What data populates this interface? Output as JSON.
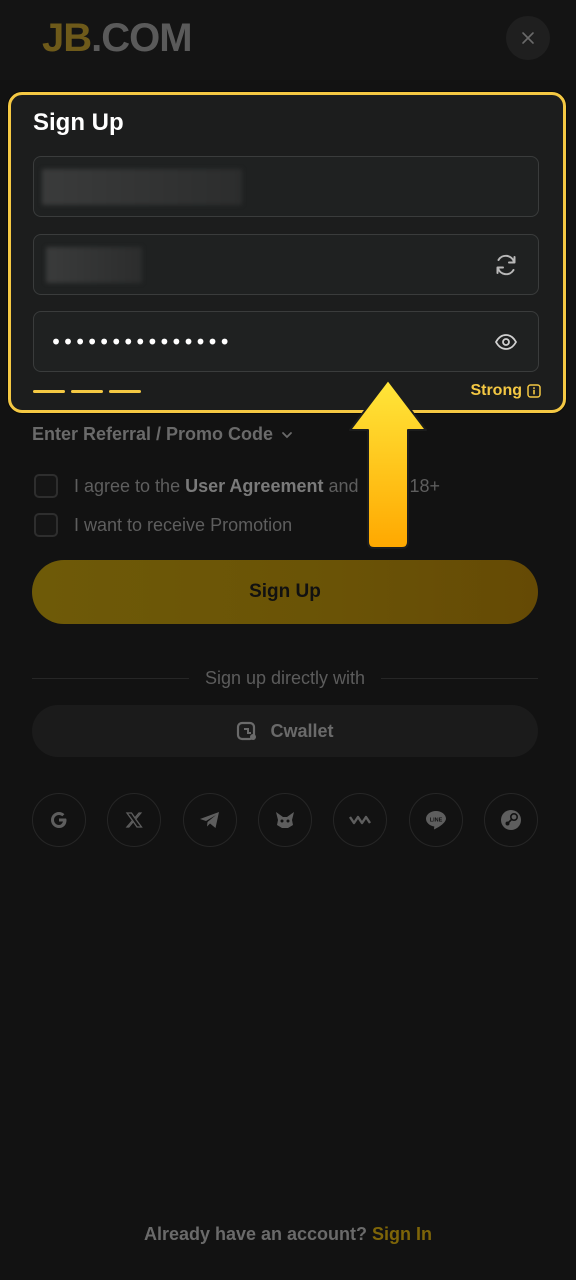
{
  "header": {
    "logo_brand": "JB",
    "logo_suffix": ".COM",
    "close_symbol": "×"
  },
  "signup_card": {
    "title": "Sign Up",
    "username_value": "",
    "captcha_value": "",
    "password_value": "•••••••••••••••",
    "strength_label": "Strong",
    "strength_bars_filled": 3,
    "border_color": "#f4c843"
  },
  "form": {
    "referral_label": "Enter Referral / Promo Code",
    "agree_prefix": "I agree to the ",
    "agree_link": "User Agreement",
    "agree_suffix": " and ",
    "agree_tail": "18+",
    "promotion_label": "I want to receive Promotion",
    "signup_button": "Sign Up"
  },
  "alt_signup": {
    "divider_text": "Sign up directly with",
    "cwallet_label": "Cwallet",
    "social_icons": [
      "google-icon",
      "x-icon",
      "telegram-icon",
      "metamask-icon",
      "walletconnect-icon",
      "line-icon",
      "steam-icon"
    ]
  },
  "footer": {
    "prompt": "Already have an account?",
    "signin_link": "Sign In"
  },
  "colors": {
    "accent": "#f4c843",
    "background": "#121212"
  }
}
